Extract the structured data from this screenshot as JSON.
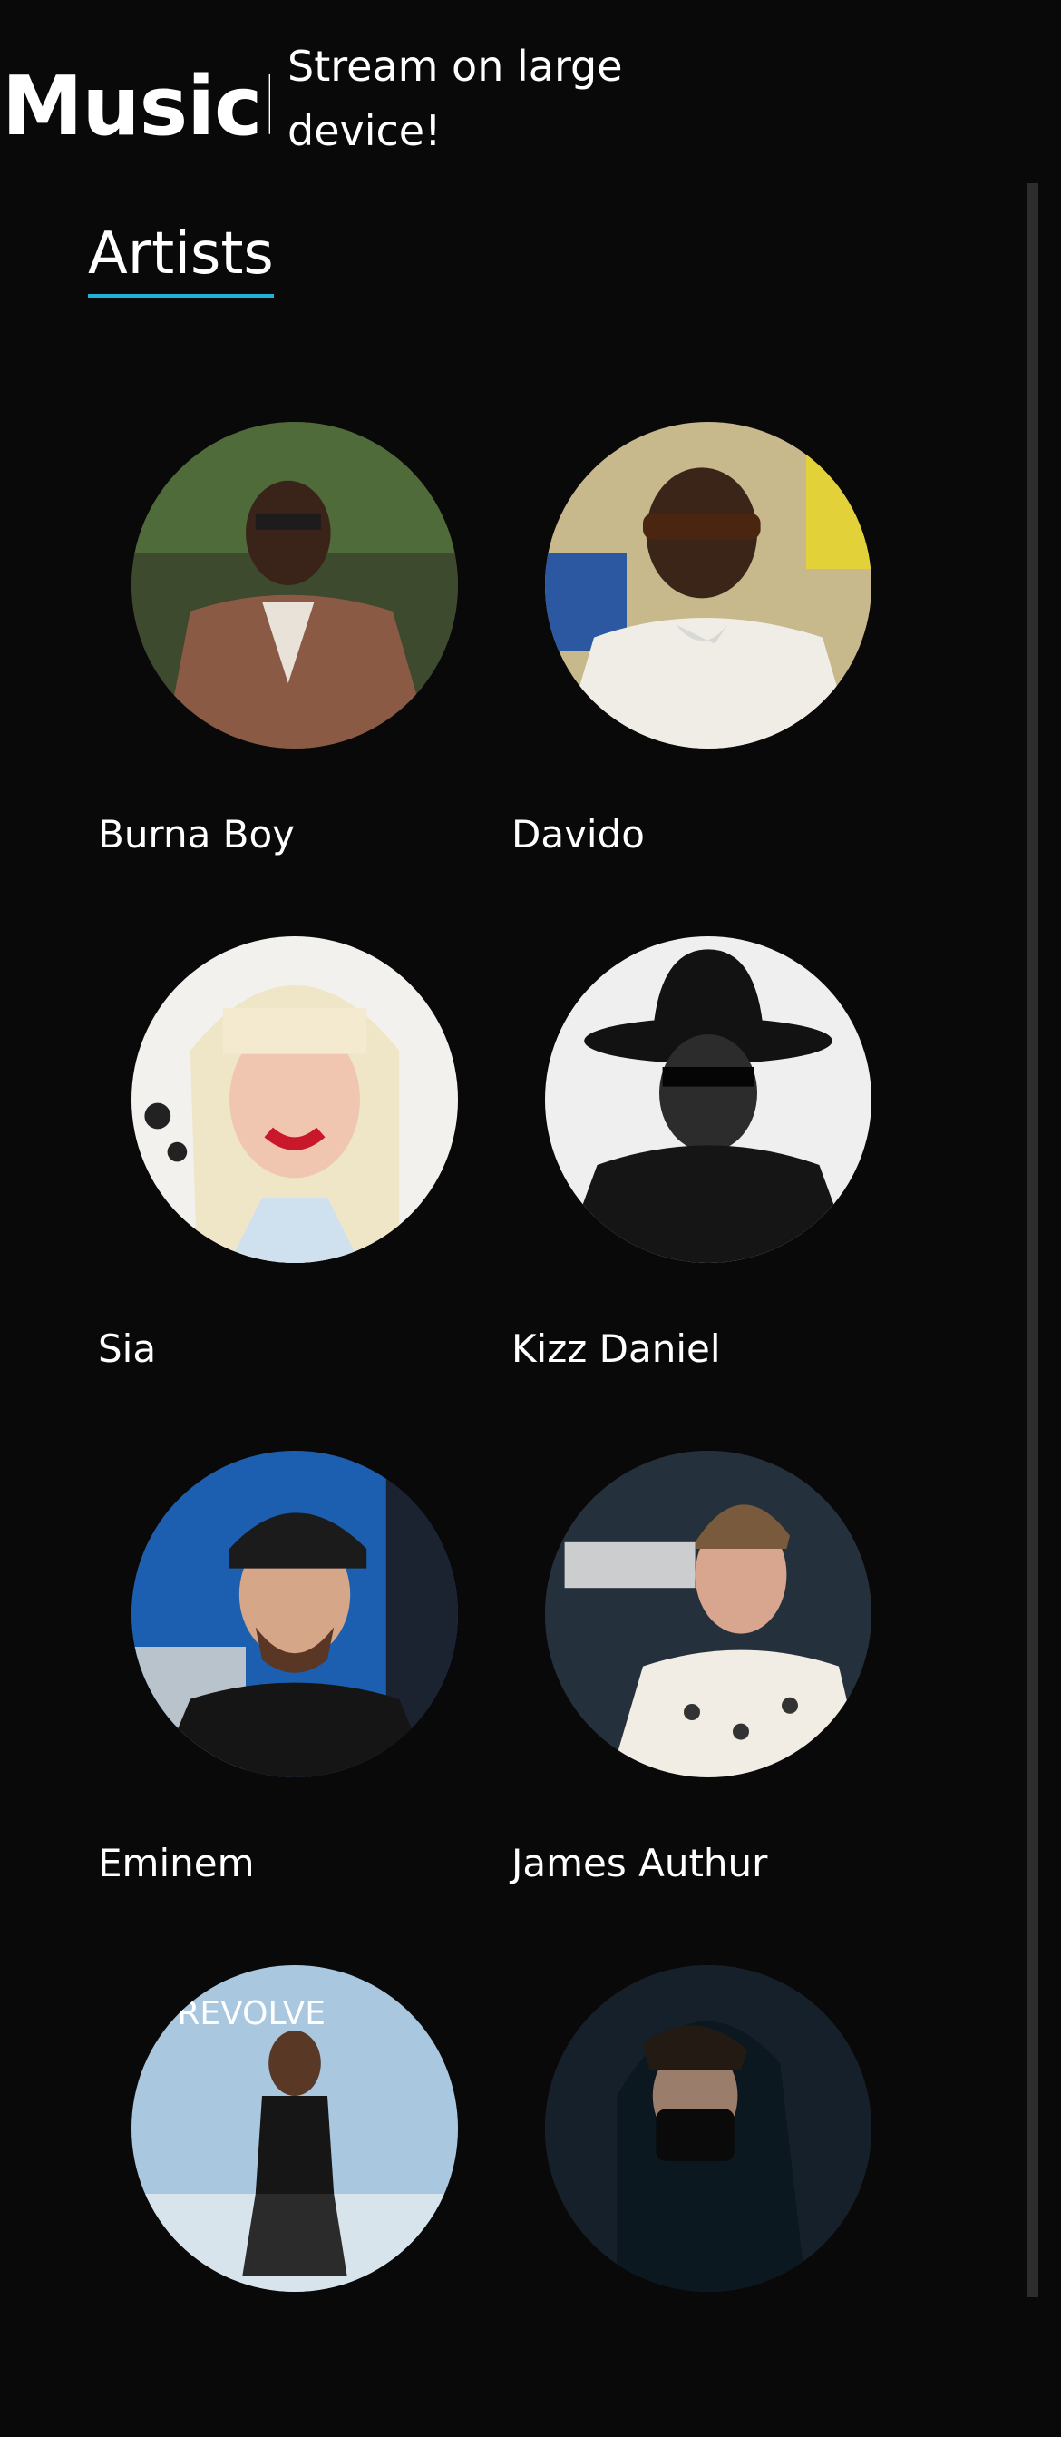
{
  "header": {
    "logo_text": "MusicPl",
    "tagline": "Stream on large device!"
  },
  "section": {
    "title": "Artists"
  },
  "artists": [
    {
      "name": "Burna Boy"
    },
    {
      "name": "Davido"
    },
    {
      "name": "Sia"
    },
    {
      "name": "Kizz Daniel"
    },
    {
      "name": "Eminem"
    },
    {
      "name": "James Authur"
    },
    {
      "name": ""
    },
    {
      "name": ""
    }
  ],
  "colors": {
    "background": "#0a0909",
    "accent_underline": "#21b0d6",
    "text": "#ffffff"
  }
}
